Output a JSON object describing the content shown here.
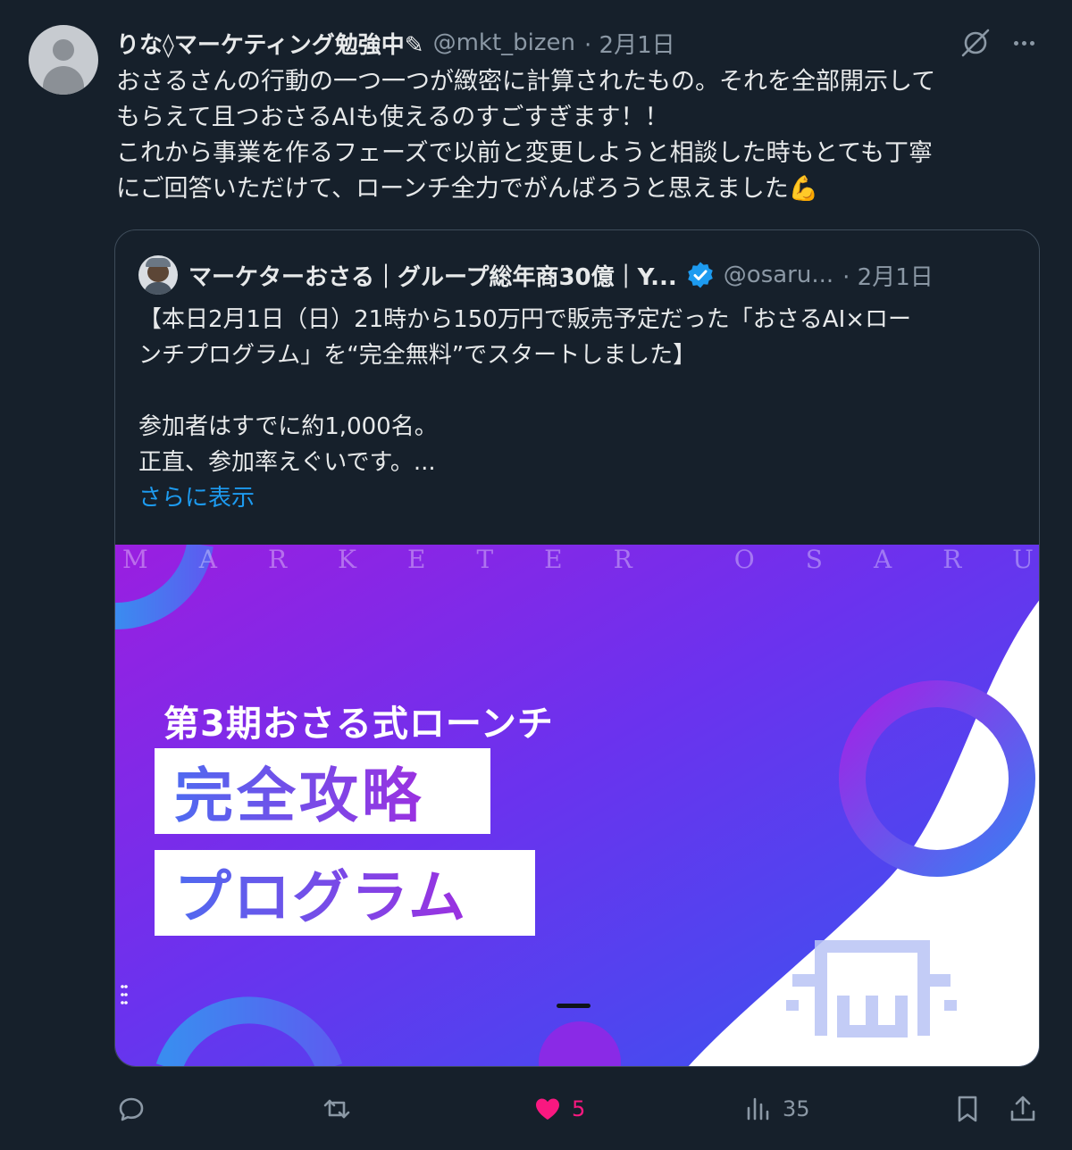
{
  "tweet": {
    "author_name": "りな◊マーケティング勉強中✎",
    "handle": "@mkt_bizen",
    "date": "· 2月1日",
    "body_lines": [
      "おさるさんの行動の一つ一つが緻密に計算されたもの。それを全部開示して",
      "もらえて且つおさるAIも使えるのすごすぎます！！",
      "これから事業を作るフェーズで以前と変更しようと相談した時もとても丁寧",
      "にご回答いただけて、ローンチ全力でがんばろうと思えました💪"
    ]
  },
  "quote": {
    "author_name": "マーケターおさる｜グループ総年商30億｜Y...",
    "handle": "@osaru...",
    "date": "· 2月1日",
    "text_lines": [
      "【本日2月1日（日）21時から150万円で販売予定だった「おさるAI×ロー",
      "ンチプログラム」を“完全無料”でスタートしました】",
      "",
      "参加者はすでに約1,000名。",
      "正直、参加率えぐいです。..."
    ],
    "show_more": "さらに表示",
    "media": {
      "letters": [
        "M",
        "A",
        "R",
        "K",
        "E",
        "T",
        "E",
        "R",
        "",
        "O",
        "S",
        "A",
        "R",
        "U"
      ],
      "subtitle": "第3期おさる式ローンチ",
      "title_line1": "完全攻略",
      "title_line2": "プログラム"
    }
  },
  "actions": {
    "reply_icon": "reply-icon",
    "retweet_icon": "retweet-icon",
    "like_count": "5",
    "views_count": "35",
    "bookmark_icon": "bookmark-icon",
    "share_icon": "share-icon",
    "like_color": "#f91880",
    "link_color": "#1d9bf0",
    "background": "#16202b"
  }
}
